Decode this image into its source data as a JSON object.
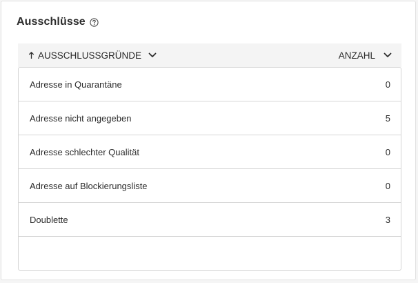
{
  "panel": {
    "title": "Ausschlüsse",
    "help_icon": "help-circle-icon"
  },
  "table": {
    "columns": [
      {
        "label": "AUSSCHLUSSGRÜNDE",
        "sort": "ascending",
        "icon_sort": "arrow-up-icon",
        "icon_menu": "chevron-down-icon"
      },
      {
        "label": "ANZAHL",
        "icon_menu": "chevron-down-icon"
      }
    ],
    "rows": [
      {
        "reason": "Adresse in Quarantäne",
        "count": "0"
      },
      {
        "reason": "Adresse nicht angegeben",
        "count": "5"
      },
      {
        "reason": "Adresse schlechter Qualität",
        "count": "0"
      },
      {
        "reason": "Adresse auf Blockierungsliste",
        "count": "0"
      },
      {
        "reason": "Doublette",
        "count": "3"
      }
    ]
  },
  "colors": {
    "header_bg": "#f4f4f4",
    "border": "#d4d4d4",
    "text": "#2c2c2c"
  }
}
